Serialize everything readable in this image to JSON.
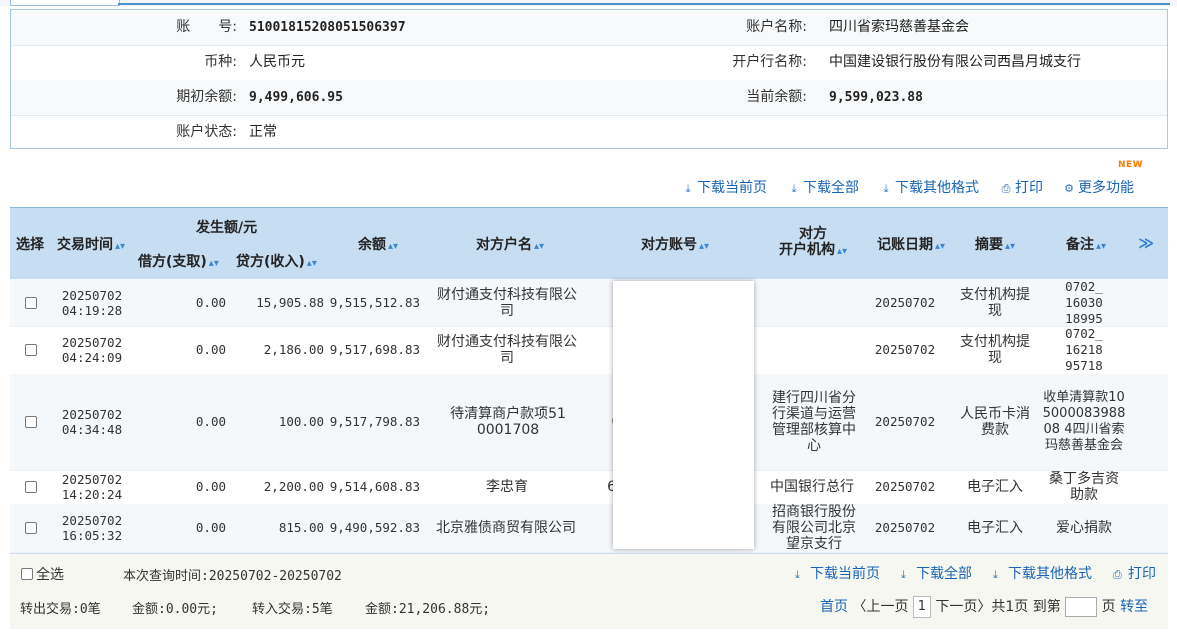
{
  "account": {
    "account_no_label": "账　　号:",
    "account_no": "51001815208051506397",
    "account_name_label": "账户名称:",
    "account_name": "四川省索玛慈善基金会",
    "currency_label": "币种:",
    "currency": "人民币元",
    "bank_label": "开户行名称:",
    "bank": "中国建设银行股份有限公司西昌月城支行",
    "opening_balance_label": "期初余额:",
    "opening_balance": "9,499,606.95",
    "current_balance_label": "当前余额:",
    "current_balance": "9,599,023.88",
    "status_label": "账户状态:",
    "status": "正常"
  },
  "toolbar": {
    "new_badge": "NEW",
    "download_page": "下载当前页",
    "download_all": "下载全部",
    "download_other": "下载其他格式",
    "print": "打印",
    "more": "更多功能"
  },
  "table": {
    "headers": {
      "select": "选择",
      "time": "交易时间",
      "amount_group": "发生额/元",
      "debit": "借方(支取)",
      "credit": "贷方(收入)",
      "balance": "余额",
      "counterparty": "对方户名",
      "counter_account": "对方账号",
      "counter_bank_1": "对方",
      "counter_bank_2": "开户机构",
      "post_date": "记账日期",
      "summary": "摘要",
      "remark": "备注",
      "more_cols": "≫"
    },
    "rows": [
      {
        "date": "20250702",
        "time": "04:19:28",
        "debit": "0.00",
        "credit": "15,905.88",
        "balance": "9,515,512.83",
        "counterparty": "财付通支付科技有限公司",
        "counter_account": "",
        "counter_bank": "",
        "post_date": "20250702",
        "summary": "支付机构提现",
        "remark": "0702_1603018995"
      },
      {
        "date": "20250702",
        "time": "04:24:09",
        "debit": "0.00",
        "credit": "2,186.00",
        "balance": "9,517,698.83",
        "counterparty": "财付通支付科技有限公司",
        "counter_account": "",
        "counter_bank": "",
        "post_date": "20250702",
        "summary": "支付机构提现",
        "remark": "0702_1621895718"
      },
      {
        "date": "20250702",
        "time": "04:34:48",
        "debit": "0.00",
        "credit": "100.00",
        "balance": "9,517,798.83",
        "counterparty": "待清算商户款项510001708",
        "counter_account": "0",
        "counter_bank": "建行四川省分行渠道与运营管理部核算中心",
        "post_date": "20250702",
        "summary": "人民币卡消费款",
        "remark": "收单清算款10500008398808 4四川省索玛慈善基金会"
      },
      {
        "date": "20250702",
        "time": "14:20:24",
        "debit": "0.00",
        "credit": "2,200.00",
        "balance": "9,514,608.83",
        "counterparty": "李忠育",
        "counter_account": "62",
        "counter_bank": "中国银行总行",
        "post_date": "20250702",
        "summary": "电子汇入",
        "remark": "桑丁多吉资助款"
      },
      {
        "date": "20250702",
        "time": "16:05:32",
        "debit": "0.00",
        "credit": "815.00",
        "balance": "9,490,592.83",
        "counterparty": "北京雅债商贸有限公司",
        "counter_account": "",
        "counter_bank": "招商银行股份有限公司北京望京支行",
        "post_date": "20250702",
        "summary": "电子汇入",
        "remark": "爱心捐款"
      }
    ]
  },
  "footer": {
    "select_all": "全选",
    "query_time": "本次查询时间:20250702-20250702",
    "download_page": "下载当前页",
    "download_all": "下载全部",
    "download_other": "下载其他格式",
    "print": "打印",
    "out_tx": "转出交易:0笔",
    "out_amount": "金额:0.00元;",
    "in_tx": "转入交易:5笔",
    "in_amount": "金额:21,206.88元;",
    "first": "首页",
    "prev": "〈上一页",
    "page": "1",
    "next": "下一页〉",
    "total": "共1页",
    "goto": "到第",
    "page_unit": "页",
    "jump": "转至"
  }
}
